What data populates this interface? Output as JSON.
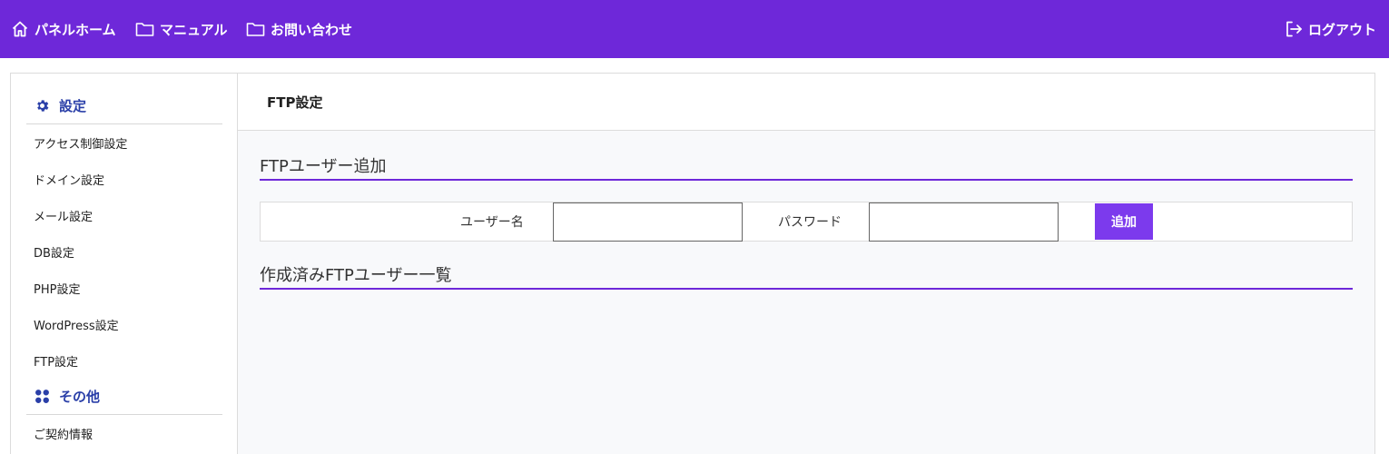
{
  "topbar": {
    "home_label": "パネルホーム",
    "manual_label": "マニュアル",
    "contact_label": "お問い合わせ",
    "logout_label": "ログアウト",
    "background": "#6e28d9"
  },
  "sidebar": {
    "sections": [
      {
        "label": "設定",
        "icon": "gear-icon",
        "items": [
          "アクセス制御設定",
          "ドメイン設定",
          "メール設定",
          "DB設定",
          "PHP設定",
          "WordPress設定",
          "FTP設定"
        ]
      },
      {
        "label": "その他",
        "icon": "grid-icon",
        "items": [
          "ご契約情報"
        ]
      }
    ],
    "accent": "#2a3fa8"
  },
  "content": {
    "page_title": "FTP設定",
    "add_section_title": "FTPユーザー追加",
    "form": {
      "username_label": "ユーザー名",
      "username_value": "",
      "password_label": "パスワード",
      "password_value": "",
      "add_button_label": "追加",
      "button_color": "#7c3aed"
    },
    "list_section_title": "作成済みFTPユーザー一覧"
  }
}
